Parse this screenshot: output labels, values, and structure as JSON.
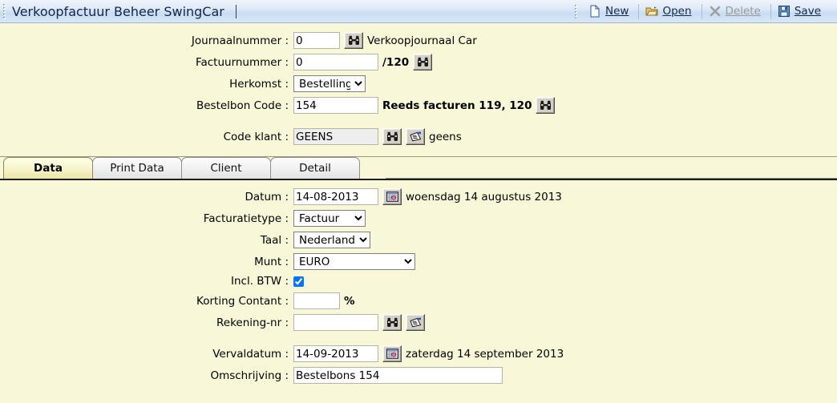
{
  "window": {
    "title": "Verkoopfactuur Beheer SwingCar"
  },
  "toolbar": {
    "new_label": "New",
    "open_label": "Open",
    "delete_label": "Delete",
    "save_label": "Save",
    "new_icon": "new-document-icon",
    "open_icon": "open-folder-icon",
    "delete_icon": "delete-x-icon",
    "save_icon": "save-floppy-icon"
  },
  "header_form": {
    "journaalnummer": {
      "label": "Journaalnummer :",
      "value": "0",
      "after": "Verkoopjournaal Car",
      "lookup_icon": "binoculars-icon"
    },
    "factuurnummer": {
      "label": "Factuurnummer :",
      "value": "0",
      "after": "/120",
      "lookup_icon": "binoculars-icon"
    },
    "herkomst": {
      "label": "Herkomst :",
      "value": "Bestelling",
      "options": [
        "Bestelling"
      ]
    },
    "bestelbon_code": {
      "label": "Bestelbon Code :",
      "value": "154",
      "after": "Reeds facturen 119, 120",
      "lookup_icon": "binoculars-icon"
    },
    "code_klant": {
      "label": "Code klant :",
      "value": "GEENS",
      "after": "geens",
      "lookup_icon": "binoculars-icon",
      "detail_icon": "note-card-icon"
    }
  },
  "tabs": [
    {
      "label": "Data",
      "active": true
    },
    {
      "label": "Print Data",
      "active": false
    },
    {
      "label": "Client",
      "active": false
    },
    {
      "label": "Detail",
      "active": false
    }
  ],
  "data_tab": {
    "datum": {
      "label": "Datum :",
      "value": "14-08-2013",
      "after": "woensdag 14 augustus 2013",
      "calendar_icon": "calendar-icon"
    },
    "facturatietype": {
      "label": "Facturatietype :",
      "value": "Factuur",
      "options": [
        "Factuur"
      ]
    },
    "taal": {
      "label": "Taal :",
      "value": "Nederlands",
      "options": [
        "Nederlands"
      ]
    },
    "munt": {
      "label": "Munt :",
      "value": "EURO",
      "options": [
        "EURO"
      ]
    },
    "incl_btw": {
      "label": "Incl. BTW :",
      "checked": true
    },
    "korting_contant": {
      "label": "Korting Contant :",
      "value": "",
      "after": "%"
    },
    "rekening_nr": {
      "label": "Rekening-nr :",
      "value": "",
      "lookup_icon": "binoculars-icon",
      "detail_icon": "note-card-icon"
    },
    "vervaldatum": {
      "label": "Vervaldatum :",
      "value": "14-09-2013",
      "after": "zaterdag 14 september 2013",
      "calendar_icon": "calendar-icon"
    },
    "omschrijving": {
      "label": "Omschrijving :",
      "value": "Bestelbons 154"
    }
  },
  "colors": {
    "body_background": "#f8f8d8",
    "titlebar_blue": "#c9dcf2",
    "active_tab": "#f7f4c9",
    "button_face": "#d4d0c8"
  }
}
